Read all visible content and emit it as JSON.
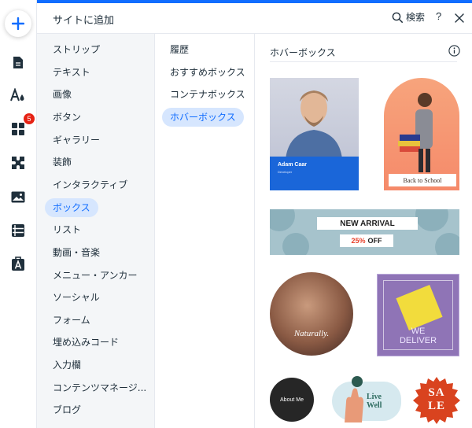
{
  "colors": {
    "accent": "#116dff",
    "badge": "#e62214",
    "selection_bg": "#d6e6fe"
  },
  "rail": {
    "badge_count": "5",
    "icons": [
      "plus-icon",
      "page-icon",
      "design-icon",
      "apps-icon",
      "puzzle-icon",
      "media-icon",
      "table-icon",
      "font-icon"
    ]
  },
  "header": {
    "title": "サイトに追加",
    "search_label": "検索",
    "help_label": "?"
  },
  "categories": [
    "ストリップ",
    "テキスト",
    "画像",
    "ボタン",
    "ギャラリー",
    "装飾",
    "インタラクティブ",
    "ボックス",
    "リスト",
    "動画・音楽",
    "メニュー・アンカー",
    "ソーシャル",
    "フォーム",
    "埋め込みコード",
    "入力欄",
    "コンテンツマネージ...",
    "ブログ"
  ],
  "active_category": "ボックス",
  "subcategories": [
    "履歴",
    "おすすめボックス",
    "コンテナボックス",
    "ホバーボックス"
  ],
  "active_subcategory": "ホバーボックス",
  "content": {
    "section_title": "ホバーボックス",
    "tiles": {
      "card": {
        "name": "Adam Caar",
        "role": "Developer"
      },
      "arch": {
        "label": "Back to School"
      },
      "banner": {
        "line1": "NEW ARRIVAL",
        "pct": "25%",
        "off": "OFF"
      },
      "circle": {
        "label": "Naturally."
      },
      "square": {
        "line1": "WE",
        "line2": "DELIVER"
      },
      "about": {
        "label": "About Me"
      },
      "blob": {
        "line1": "Live",
        "line2": "Well"
      },
      "sale": {
        "line1": "SA",
        "line2": "LE"
      }
    }
  }
}
